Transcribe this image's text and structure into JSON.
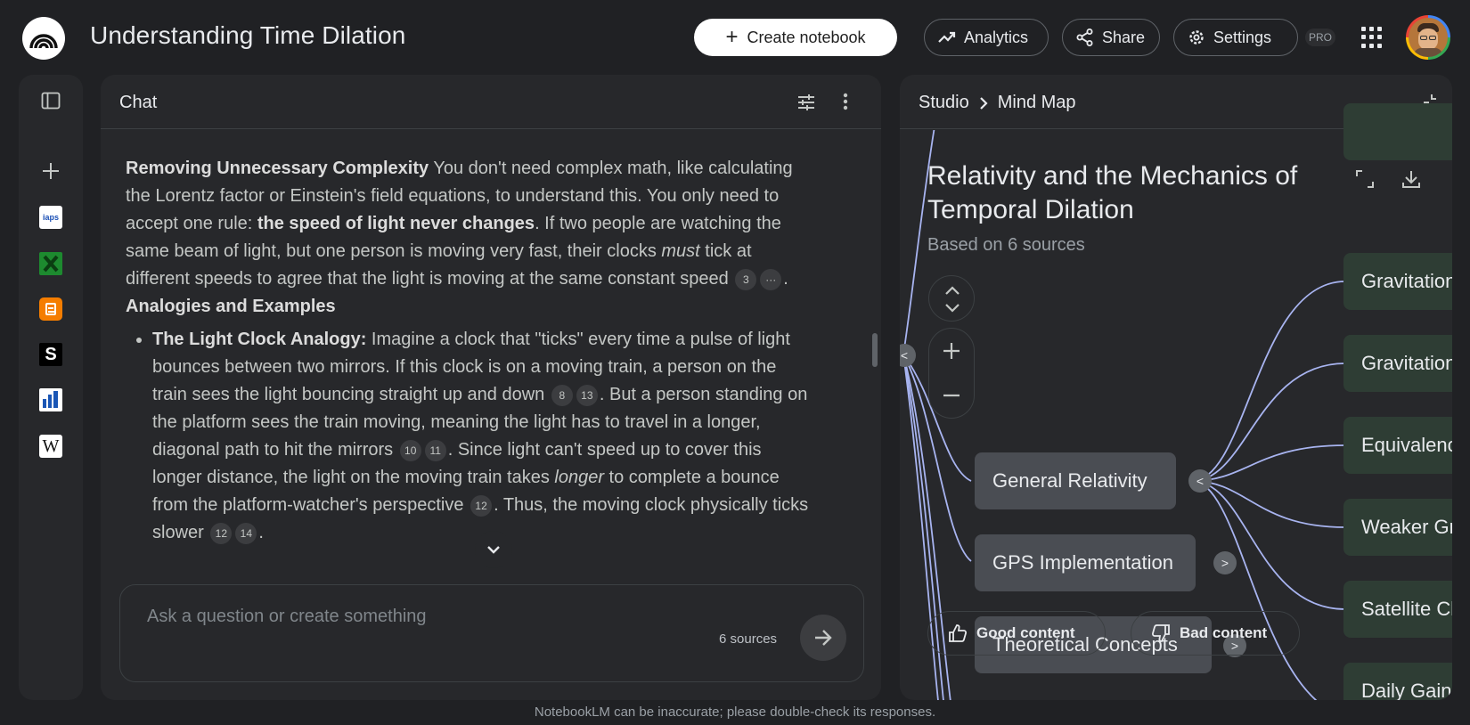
{
  "app": {
    "title": "Understanding Time Dilation",
    "create_label": "Create notebook",
    "analytics_label": "Analytics",
    "share_label": "Share",
    "settings_label": "Settings",
    "pro_badge": "PRO"
  },
  "sidebar": {
    "items": [
      "add-source",
      "iaps-source",
      "excel-source",
      "blogger-source",
      "s-source",
      "chart-source",
      "wikipedia-source"
    ]
  },
  "chat": {
    "title": "Chat",
    "p1_bold": "Removing Unnecessary Complexity",
    "p1_a": " You don't need complex math, like calculating the Lorentz factor or Einstein's field equations, to understand this. You only need to accept one rule: ",
    "p1_bold2": "the speed of light never changes",
    "p1_b": ". If two people are watching the same beam of light, but one person is moving very fast, their clocks ",
    "p1_em": "must",
    "p1_c": " tick at different speeds to agree that the light is moving at the same constant speed",
    "p1_cite1": "3",
    "p1_cite2": "···",
    "p1_end": ".",
    "heading": "Analogies and Examples",
    "li_bold": "The Light Clock Analogy:",
    "li_a": " Imagine a clock that \"ticks\" every time a pulse of light bounces between two mirrors. If this clock is on a moving train, a person on the train sees the light bouncing straight up and down",
    "li_c1": "8",
    "li_c2": "13",
    "li_b": ". But a person standing on the platform sees the train moving, meaning the light has to travel in a longer, diagonal path to hit the mirrors",
    "li_c3": "10",
    "li_c4": "11",
    "li_c": ". Since light can't speed up to cover this longer distance, the light on the moving train takes ",
    "li_em": "longer",
    "li_d": " to complete a bounce from the platform-watcher's perspective",
    "li_c5": "12",
    "li_e": ". Thus, the moving clock physically ticks slower",
    "li_c6": "12",
    "li_c7": "14",
    "li_end": ".",
    "placeholder": "Ask a question or create something",
    "sources_count": "6 sources"
  },
  "studio": {
    "crumb_root": "Studio",
    "crumb_current": "Mind Map",
    "map_title": "Relativity and the Mechanics of Temporal Dilation",
    "map_subtitle": "Based on 6 sources",
    "nodes": {
      "general": "General Relativity",
      "gps": "GPS Implementation",
      "theoretical": "Theoretical Concepts"
    },
    "right_nodes": [
      "Gravitational Time Dilation",
      "Gravitational Potential",
      "Equivalence Principle",
      "Weaker Gravity",
      "Satellite Clocks",
      "Daily Gain"
    ],
    "good_label": "Good content",
    "bad_label": "Bad content"
  },
  "footer": "NotebookLM can be inaccurate; please double-check its responses."
}
